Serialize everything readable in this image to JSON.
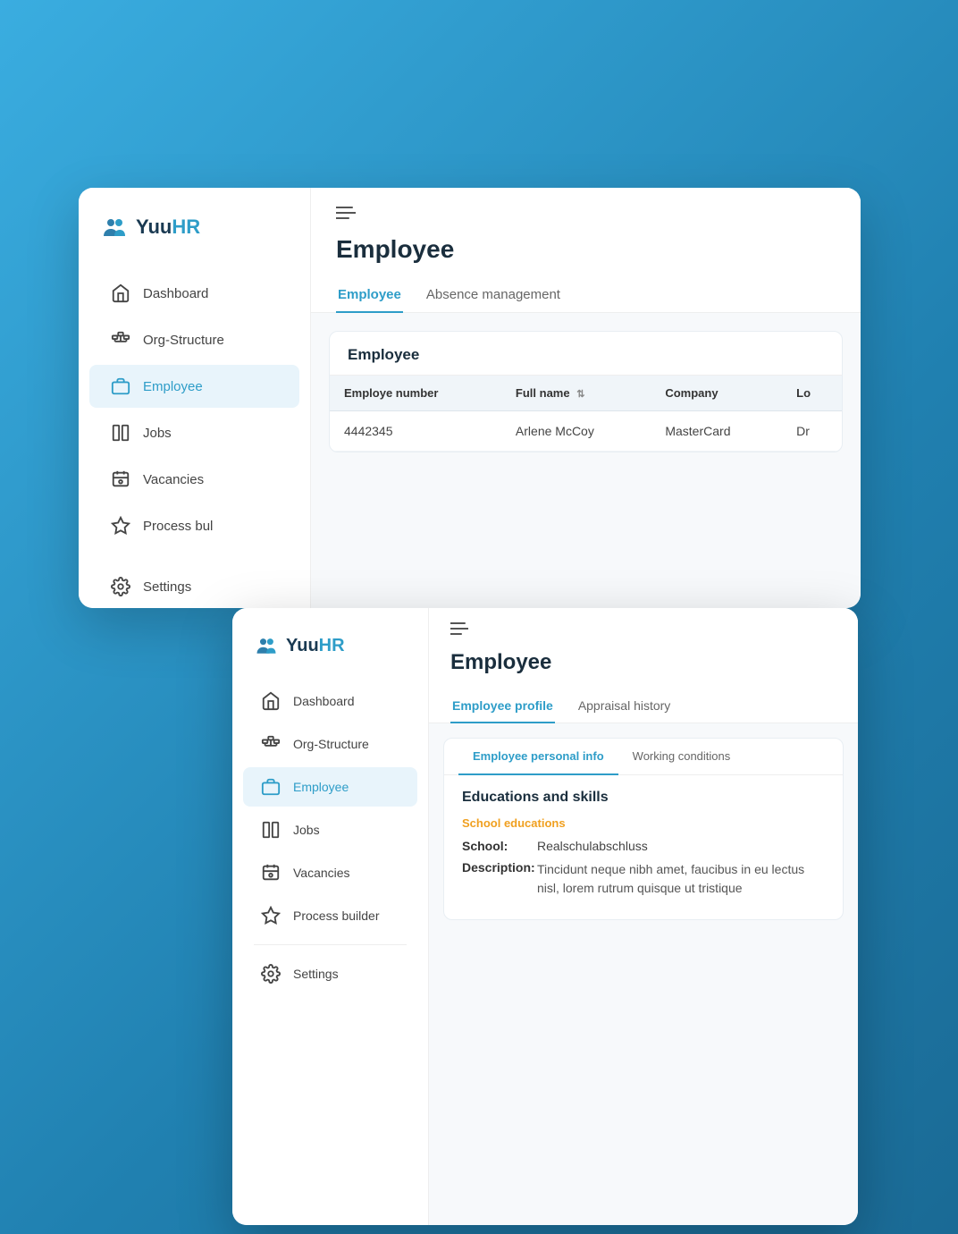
{
  "background": {
    "color": "#2e9dc8"
  },
  "window1": {
    "sidebar": {
      "logo": {
        "yuu": "Yuu",
        "hr": "HR"
      },
      "nav": [
        {
          "id": "dashboard",
          "label": "Dashboard",
          "icon": "home"
        },
        {
          "id": "org-structure",
          "label": "Org-Structure",
          "icon": "org"
        },
        {
          "id": "employee",
          "label": "Employee",
          "icon": "briefcase",
          "active": true
        },
        {
          "id": "jobs",
          "label": "Jobs",
          "icon": "jobs"
        },
        {
          "id": "vacancies",
          "label": "Vacancies",
          "icon": "vacancies"
        },
        {
          "id": "process-builder",
          "label": "Process bul",
          "icon": "process"
        },
        {
          "id": "settings",
          "label": "Settings",
          "icon": "settings"
        }
      ]
    },
    "main": {
      "page_title": "Employee",
      "tabs": [
        {
          "label": "Employee",
          "active": true
        },
        {
          "label": "Absence management",
          "active": false
        }
      ],
      "table": {
        "section_title": "Employee",
        "columns": [
          "Employe number",
          "Full name",
          "Company",
          "Lo"
        ],
        "rows": [
          {
            "number": "4442345",
            "full_name": "Arlene McCoy",
            "company": "MasterCard",
            "extra": "Dr"
          }
        ]
      }
    }
  },
  "window2": {
    "sidebar": {
      "logo": {
        "yuu": "Yuu",
        "hr": "HR"
      },
      "nav": [
        {
          "id": "dashboard",
          "label": "Dashboard",
          "icon": "home"
        },
        {
          "id": "org-structure",
          "label": "Org-Structure",
          "icon": "org"
        },
        {
          "id": "employee",
          "label": "Employee",
          "icon": "briefcase",
          "active": true
        },
        {
          "id": "jobs",
          "label": "Jobs",
          "icon": "jobs"
        },
        {
          "id": "vacancies",
          "label": "Vacancies",
          "icon": "vacancies"
        },
        {
          "id": "process-builder",
          "label": "Process builder",
          "icon": "process"
        },
        {
          "id": "settings",
          "label": "Settings",
          "icon": "settings"
        }
      ]
    },
    "main": {
      "page_title": "Employee",
      "tabs": [
        {
          "label": "Employee profile",
          "active": true
        },
        {
          "label": "Appraisal history",
          "active": false
        }
      ],
      "sub_tabs": [
        {
          "label": "Employee personal info",
          "active": true
        },
        {
          "label": "Working conditions",
          "active": false
        }
      ],
      "education": {
        "title": "Educations and skills",
        "section_label": "School educations",
        "school_label": "School:",
        "school_value": "Realschulabschluss",
        "description_label": "Description:",
        "description_value": "Tincidunt neque nibh amet, faucibus in eu lectus nisl, lorem rutrum quisque ut tristique"
      }
    }
  }
}
